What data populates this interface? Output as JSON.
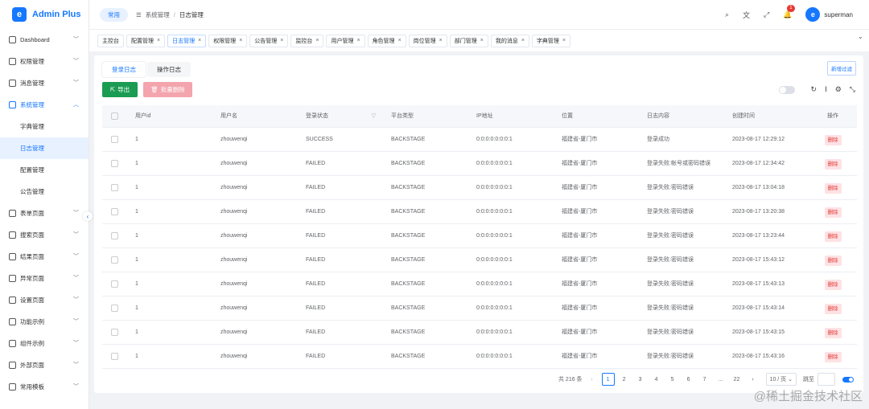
{
  "app": {
    "name": "Admin Plus",
    "logo_letter": "e"
  },
  "sidebar": {
    "items": [
      {
        "label": "Dashboard",
        "expanded": false
      },
      {
        "label": "权限管理",
        "expanded": false
      },
      {
        "label": "消息管理",
        "expanded": false
      },
      {
        "label": "系统管理",
        "expanded": true
      },
      {
        "label": "表单页面",
        "expanded": false
      },
      {
        "label": "搜索页面",
        "expanded": false
      },
      {
        "label": "结果页面",
        "expanded": false
      },
      {
        "label": "异常页面",
        "expanded": false
      },
      {
        "label": "设置页面",
        "expanded": false
      },
      {
        "label": "功能示例",
        "expanded": false
      },
      {
        "label": "组件示例",
        "expanded": false
      },
      {
        "label": "外部页面",
        "expanded": false
      },
      {
        "label": "常用模板",
        "expanded": false
      }
    ],
    "system_children": [
      "字典管理",
      "日志管理",
      "配置管理",
      "公告管理"
    ],
    "active_child": "日志管理"
  },
  "header": {
    "env_pill": "常用",
    "breadcrumb": [
      "系统管理",
      "日志管理"
    ],
    "notification_count": "1",
    "username": "superman",
    "avatar_letter": "e"
  },
  "tabs": [
    {
      "label": "主控台",
      "closable": false
    },
    {
      "label": "配置管理",
      "closable": true
    },
    {
      "label": "日志管理",
      "closable": true,
      "active": true
    },
    {
      "label": "权限管理",
      "closable": true
    },
    {
      "label": "公告管理",
      "closable": true
    },
    {
      "label": "监控台",
      "closable": true
    },
    {
      "label": "用户管理",
      "closable": true
    },
    {
      "label": "角色管理",
      "closable": true
    },
    {
      "label": "岗位管理",
      "closable": true
    },
    {
      "label": "部门管理",
      "closable": true
    },
    {
      "label": "我的消息",
      "closable": true
    },
    {
      "label": "字典管理",
      "closable": true
    }
  ],
  "subtabs": [
    "登录日志",
    "操作日志"
  ],
  "toolbar": {
    "add_filter": "新增过滤",
    "export": "导出",
    "batch_delete": "批量删除"
  },
  "table": {
    "columns": [
      "用户id",
      "用户名",
      "登录状态",
      "平台类型",
      "IP地址",
      "位置",
      "日志内容",
      "创建时间",
      "操作"
    ],
    "rows": [
      [
        "1",
        "zhouwenqi",
        "SUCCESS",
        "BACKSTAGE",
        "0:0:0:0:0:0:0:1",
        "福建省-厦门市",
        "登录成功",
        "2023-08-17 12:29:12",
        "删除"
      ],
      [
        "1",
        "zhouwenqi",
        "FAILED",
        "BACKSTAGE",
        "0:0:0:0:0:0:0:1",
        "福建省-厦门市",
        "登录失败:帐号或密码错误",
        "2023-08-17 12:34:42",
        "删除"
      ],
      [
        "1",
        "zhouwenqi",
        "FAILED",
        "BACKSTAGE",
        "0:0:0:0:0:0:0:1",
        "福建省-厦门市",
        "登录失败:密码错误",
        "2023-08-17 13:04:18",
        "删除"
      ],
      [
        "1",
        "zhouwenqi",
        "FAILED",
        "BACKSTAGE",
        "0:0:0:0:0:0:0:1",
        "福建省-厦门市",
        "登录失败:密码错误",
        "2023-08-17 13:20:38",
        "删除"
      ],
      [
        "1",
        "zhouwenqi",
        "FAILED",
        "BACKSTAGE",
        "0:0:0:0:0:0:0:1",
        "福建省-厦门市",
        "登录失败:密码错误",
        "2023-08-17 13:23:44",
        "删除"
      ],
      [
        "1",
        "zhouwenqi",
        "FAILED",
        "BACKSTAGE",
        "0:0:0:0:0:0:0:1",
        "福建省-厦门市",
        "登录失败:密码错误",
        "2023-08-17 15:43:12",
        "删除"
      ],
      [
        "1",
        "zhouwenqi",
        "FAILED",
        "BACKSTAGE",
        "0:0:0:0:0:0:0:1",
        "福建省-厦门市",
        "登录失败:密码错误",
        "2023-08-17 15:43:13",
        "删除"
      ],
      [
        "1",
        "zhouwenqi",
        "FAILED",
        "BACKSTAGE",
        "0:0:0:0:0:0:0:1",
        "福建省-厦门市",
        "登录失败:密码错误",
        "2023-08-17 15:43:14",
        "删除"
      ],
      [
        "1",
        "zhouwenqi",
        "FAILED",
        "BACKSTAGE",
        "0:0:0:0:0:0:0:1",
        "福建省-厦门市",
        "登录失败:密码错误",
        "2023-08-17 15:43:15",
        "删除"
      ],
      [
        "1",
        "zhouwenqi",
        "FAILED",
        "BACKSTAGE",
        "0:0:0:0:0:0:0:1",
        "福建省-厦门市",
        "登录失败:密码错误",
        "2023-08-17 15:43:16",
        "删除"
      ]
    ]
  },
  "pagination": {
    "total_text": "共 216 条",
    "pages": [
      "1",
      "2",
      "3",
      "4",
      "5",
      "6",
      "7",
      "...",
      "22"
    ],
    "current": "1",
    "page_size": "10 / 页",
    "jump_label": "跳至"
  },
  "watermark": "@稀土掘金技术社区",
  "colors": {
    "primary": "#1677ff",
    "export": "#1a9c52",
    "danger_light": "#f3a4ad"
  }
}
